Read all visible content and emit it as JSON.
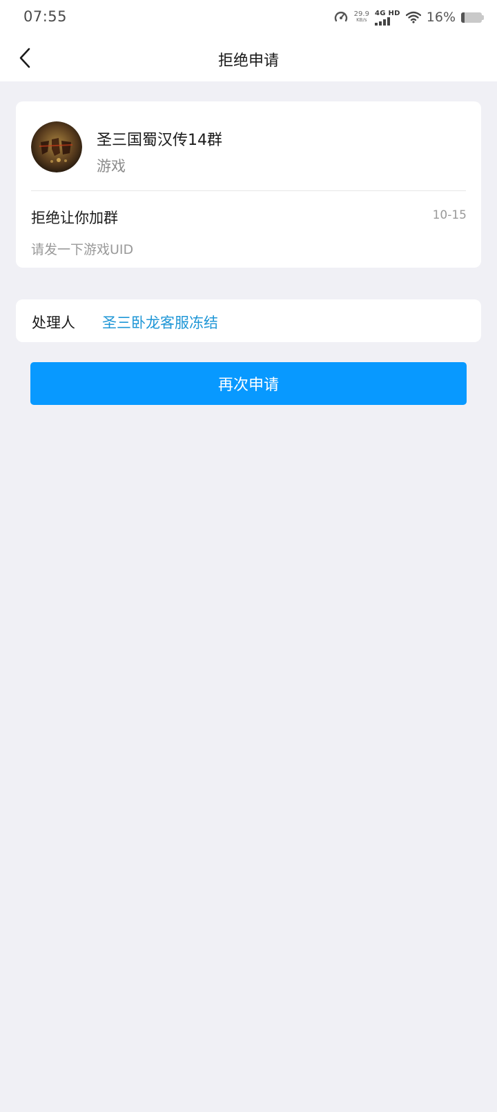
{
  "status_bar": {
    "time": "07:55",
    "speed_value": "29.9",
    "speed_unit": "KB/s",
    "network": "4G HD",
    "battery_percent": "16%",
    "battery_level": 0.16
  },
  "navbar": {
    "title": "拒绝申请",
    "back_icon": "chevron-left-icon"
  },
  "group": {
    "name": "圣三国蜀汉传14群",
    "category": "游戏",
    "avatar_icon": "game-avatar-icon"
  },
  "rejection": {
    "title": "拒绝让你加群",
    "date": "10-15",
    "reason": "请发一下游戏UID"
  },
  "handler": {
    "label": "处理人",
    "name": "圣三卧龙客服冻结"
  },
  "actions": {
    "reapply_label": "再次申请"
  },
  "colors": {
    "accent": "#0899ff",
    "link": "#1e96d6",
    "background": "#f0f0f5"
  }
}
